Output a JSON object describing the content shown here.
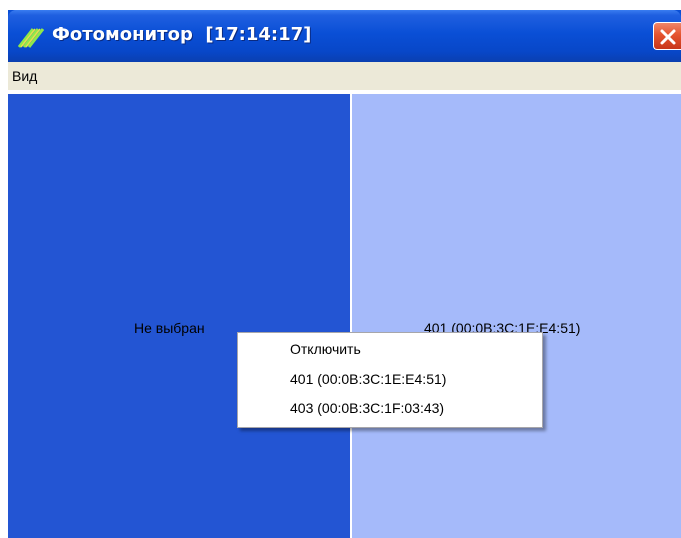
{
  "window": {
    "title": "Фотомонитор  [17:14:17]",
    "close_icon": "close-icon"
  },
  "menubar": {
    "items": [
      {
        "label": "Вид"
      }
    ]
  },
  "panes": {
    "left": {
      "label": "Не выбран",
      "color": "#2355d3"
    },
    "right": {
      "label": "401 (00:0B:3C:1E:E4:51)",
      "color": "#a5bafa"
    }
  },
  "context_menu": {
    "items": [
      {
        "label": "Отключить"
      },
      {
        "label": "401 (00:0B:3C:1E:E4:51)"
      },
      {
        "label": "403 (00:0B:3C:1F:03:43)"
      }
    ]
  },
  "colors": {
    "titlebar": "#0a4fd6",
    "menubar": "#ece9d8",
    "close": "#e5542f"
  }
}
